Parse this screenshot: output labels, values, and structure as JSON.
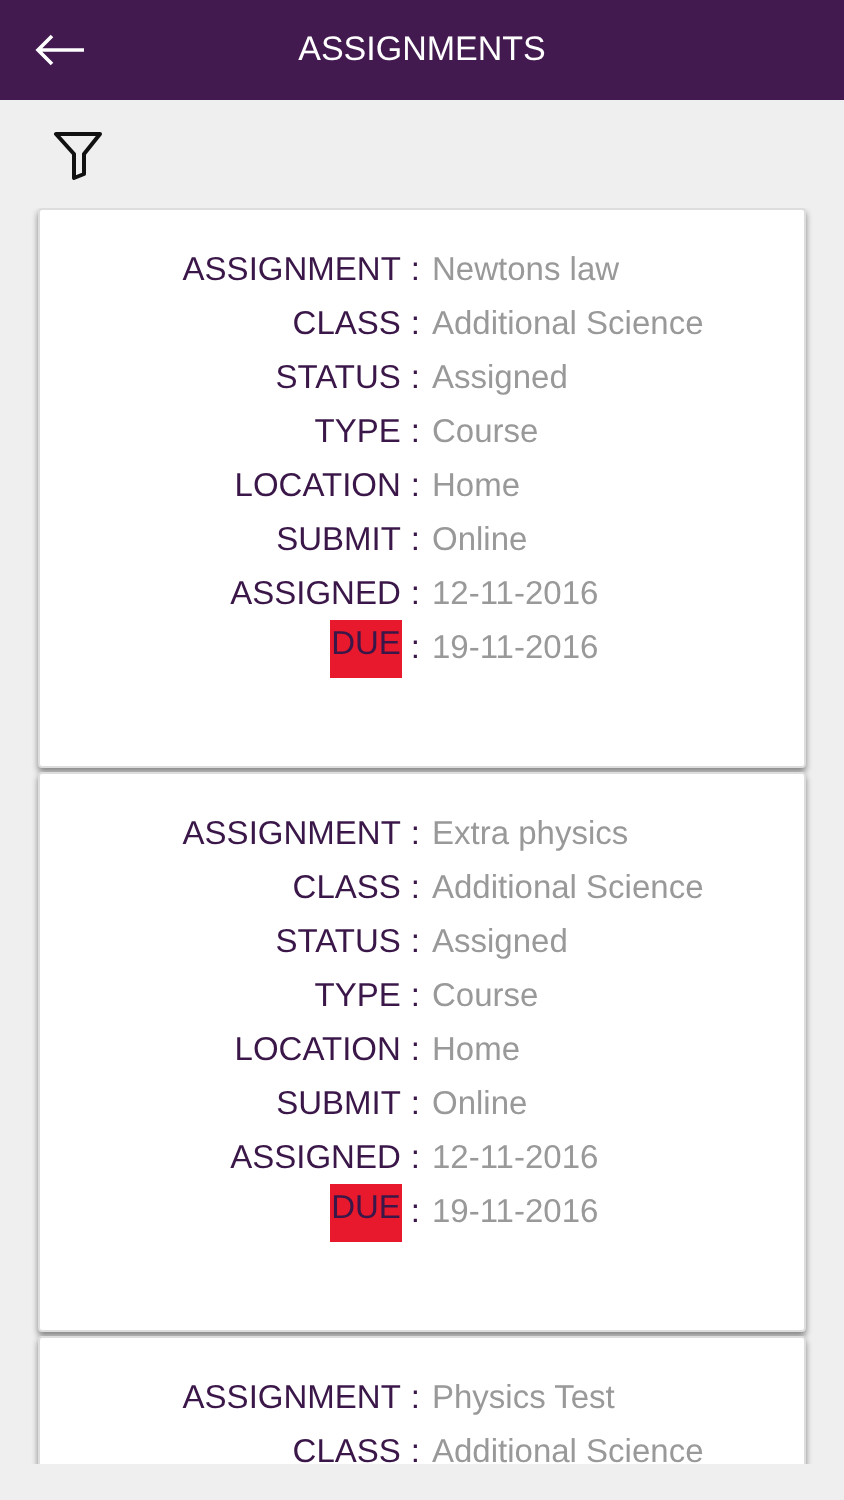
{
  "header": {
    "title": "ASSIGNMENTS"
  },
  "assignments": [
    {
      "fields": [
        {
          "label": "ASSIGNMENT",
          "sep": ":",
          "value": "Newtons law",
          "highlighted": false
        },
        {
          "label": "CLASS",
          "sep": ":",
          "value": "Additional Science",
          "highlighted": false
        },
        {
          "label": "STATUS",
          "sep": ":",
          "value": "Assigned",
          "highlighted": false
        },
        {
          "label": "TYPE",
          "sep": ":",
          "value": "Course",
          "highlighted": false
        },
        {
          "label": "LOCATION",
          "sep": ":",
          "value": "Home",
          "highlighted": false
        },
        {
          "label": "SUBMIT",
          "sep": ":",
          "value": "Online",
          "highlighted": false
        },
        {
          "label": "ASSIGNED",
          "sep": ":",
          "value": "12-11-2016",
          "highlighted": false
        },
        {
          "label": "DUE",
          "sep": ":",
          "value": "19-11-2016",
          "highlighted": true
        }
      ]
    },
    {
      "fields": [
        {
          "label": "ASSIGNMENT",
          "sep": ":",
          "value": "Extra physics",
          "highlighted": false
        },
        {
          "label": "CLASS",
          "sep": ":",
          "value": "Additional Science",
          "highlighted": false
        },
        {
          "label": "STATUS",
          "sep": ":",
          "value": "Assigned",
          "highlighted": false
        },
        {
          "label": "TYPE",
          "sep": ":",
          "value": "Course",
          "highlighted": false
        },
        {
          "label": "LOCATION",
          "sep": ":",
          "value": "Home",
          "highlighted": false
        },
        {
          "label": "SUBMIT",
          "sep": ":",
          "value": "Online",
          "highlighted": false
        },
        {
          "label": "ASSIGNED",
          "sep": ":",
          "value": "12-11-2016",
          "highlighted": false
        },
        {
          "label": "DUE",
          "sep": ":",
          "value": "19-11-2016",
          "highlighted": true
        }
      ]
    },
    {
      "fields": [
        {
          "label": "ASSIGNMENT",
          "sep": ":",
          "value": "Physics Test",
          "highlighted": false
        },
        {
          "label": "CLASS",
          "sep": ":",
          "value": "Additional Science",
          "highlighted": false
        }
      ]
    }
  ]
}
